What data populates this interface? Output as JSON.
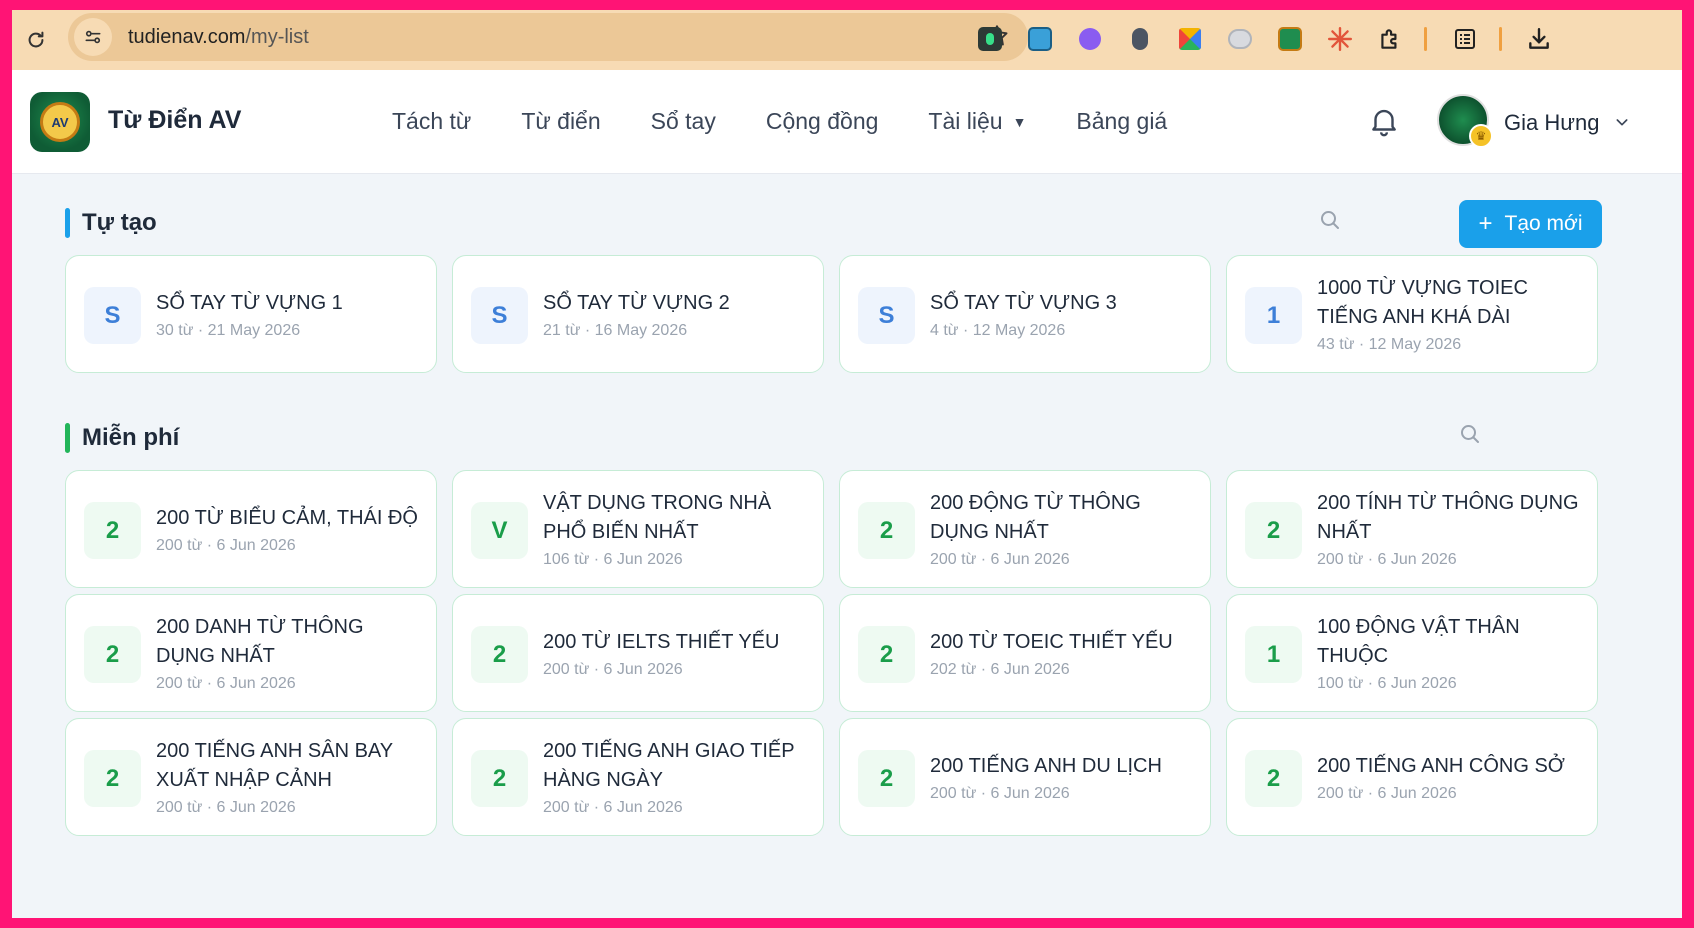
{
  "browser": {
    "url_host": "tudienav.com",
    "url_path": "/my-list"
  },
  "header": {
    "brand": "Từ Điển AV",
    "logo_text": "AV",
    "nav": [
      {
        "label": "Tách từ"
      },
      {
        "label": "Từ điển"
      },
      {
        "label": "Sổ tay"
      },
      {
        "label": "Cộng đồng"
      },
      {
        "label": "Tài liệu",
        "dropdown": true
      },
      {
        "label": "Bảng giá"
      }
    ],
    "username": "Gia Hưng"
  },
  "colors": {
    "accent": "#1aa0ea",
    "section_own": "#1aa0ea",
    "section_free": "#22b55a"
  },
  "own_section": {
    "title": "Tự tạo",
    "create_label": "Tạo mới",
    "lists": [
      {
        "initial": "S",
        "name": "SỔ TAY TỪ VỰNG 1",
        "meta": "30 từ · 21 May 2026"
      },
      {
        "initial": "S",
        "name": "SỔ TAY TỪ VỰNG 2",
        "meta": "21 từ · 16 May 2026"
      },
      {
        "initial": "S",
        "name": "SỔ TAY TỪ VỰNG 3",
        "meta": "4 từ · 12 May 2026"
      },
      {
        "initial": "1",
        "name": "1000 TỪ VỰNG TOIEC TIẾNG ANH KHÁ DÀI",
        "meta": "43 từ · 12 May 2026"
      }
    ]
  },
  "free_section": {
    "title": "Miễn phí",
    "lists": [
      {
        "initial": "2",
        "name": "200 TỪ BIỂU CẢM, THÁI ĐỘ",
        "meta": "200 từ · 6 Jun 2026"
      },
      {
        "initial": "V",
        "name": "VẬT DỤNG TRONG NHÀ PHỔ BIẾN NHẤT",
        "meta": "106 từ · 6 Jun 2026"
      },
      {
        "initial": "2",
        "name": "200 ĐỘNG TỪ THÔNG DỤNG NHẤT",
        "meta": "200 từ · 6 Jun 2026"
      },
      {
        "initial": "2",
        "name": "200 TÍNH TỪ THÔNG DỤNG NHẤT",
        "meta": "200 từ · 6 Jun 2026"
      },
      {
        "initial": "2",
        "name": "200 DANH TỪ THÔNG DỤNG NHẤT",
        "meta": "200 từ · 6 Jun 2026"
      },
      {
        "initial": "2",
        "name": "200 TỪ IELTS THIẾT YẾU",
        "meta": "200 từ · 6 Jun 2026"
      },
      {
        "initial": "2",
        "name": "200 TỪ TOEIC THIẾT YẾU",
        "meta": "202 từ · 6 Jun 2026"
      },
      {
        "initial": "1",
        "name": "100 ĐỘNG VẬT THÂN THUỘC",
        "meta": "100 từ · 6 Jun 2026"
      },
      {
        "initial": "2",
        "name": "200 TIẾNG ANH SÂN BAY XUẤT NHẬP CẢNH",
        "meta": "200 từ · 6 Jun 2026"
      },
      {
        "initial": "2",
        "name": "200 TIẾNG ANH GIAO TIẾP HÀNG NGÀY",
        "meta": "200 từ · 6 Jun 2026"
      },
      {
        "initial": "2",
        "name": "200 TIẾNG ANH DU LỊCH",
        "meta": "200 từ · 6 Jun 2026"
      },
      {
        "initial": "2",
        "name": "200 TIẾNG ANH CÔNG SỞ",
        "meta": "200 từ · 6 Jun 2026"
      }
    ]
  }
}
